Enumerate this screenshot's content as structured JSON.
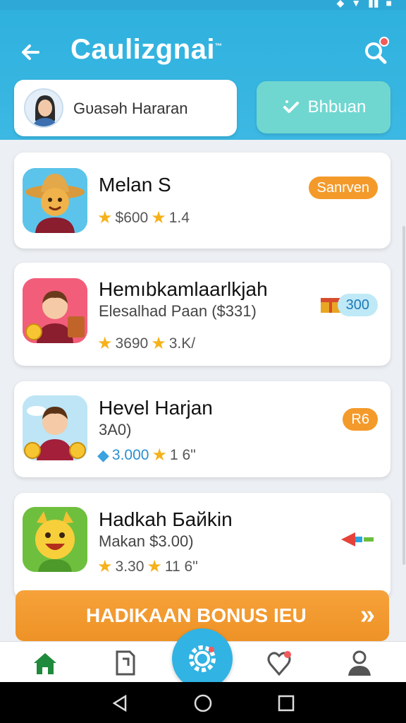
{
  "app": {
    "title": "Caulizgnai",
    "title_mark": "™"
  },
  "profile": {
    "name": "Gυasəh Hararan"
  },
  "action_button": {
    "label": "Bhbuan"
  },
  "cards": [
    {
      "title": "Melan S",
      "subtitle": "",
      "stat1": "$600",
      "stat2": "1.4",
      "pill": "Sanrven",
      "pill_style": "orange"
    },
    {
      "title": "Hemıbkamlaarlkjah",
      "subtitle": "Elesalhad Paan ($331)",
      "stat1": "3690",
      "stat2": "3.K/",
      "pill": "300",
      "pill_style": "blue"
    },
    {
      "title": "Hevel Harjan",
      "subtitle": "3A0)",
      "stat1": "3.000",
      "stat2": "1 6\"",
      "pill": "R6",
      "pill_style": "orange"
    },
    {
      "title": "Hadkah Байkin",
      "subtitle": "Makan $3.00)",
      "stat1": "3.30",
      "stat2": "11 6\"",
      "pill": "",
      "pill_style": "none"
    }
  ],
  "bonus": {
    "label": "HADIKAAN BONUS IEU",
    "chevron": "»"
  },
  "colors": {
    "header": "#2fb1de",
    "accent_orange": "#f39a2b",
    "action_teal": "#6fd7d0",
    "star": "#f6b21c"
  },
  "icons": {
    "back": "arrow-left-icon",
    "search": "search-icon",
    "home": "home-icon",
    "document": "document-icon",
    "settings_gear": "gear-icon",
    "heart_pin": "heart-pin-icon",
    "profile": "user-icon"
  }
}
